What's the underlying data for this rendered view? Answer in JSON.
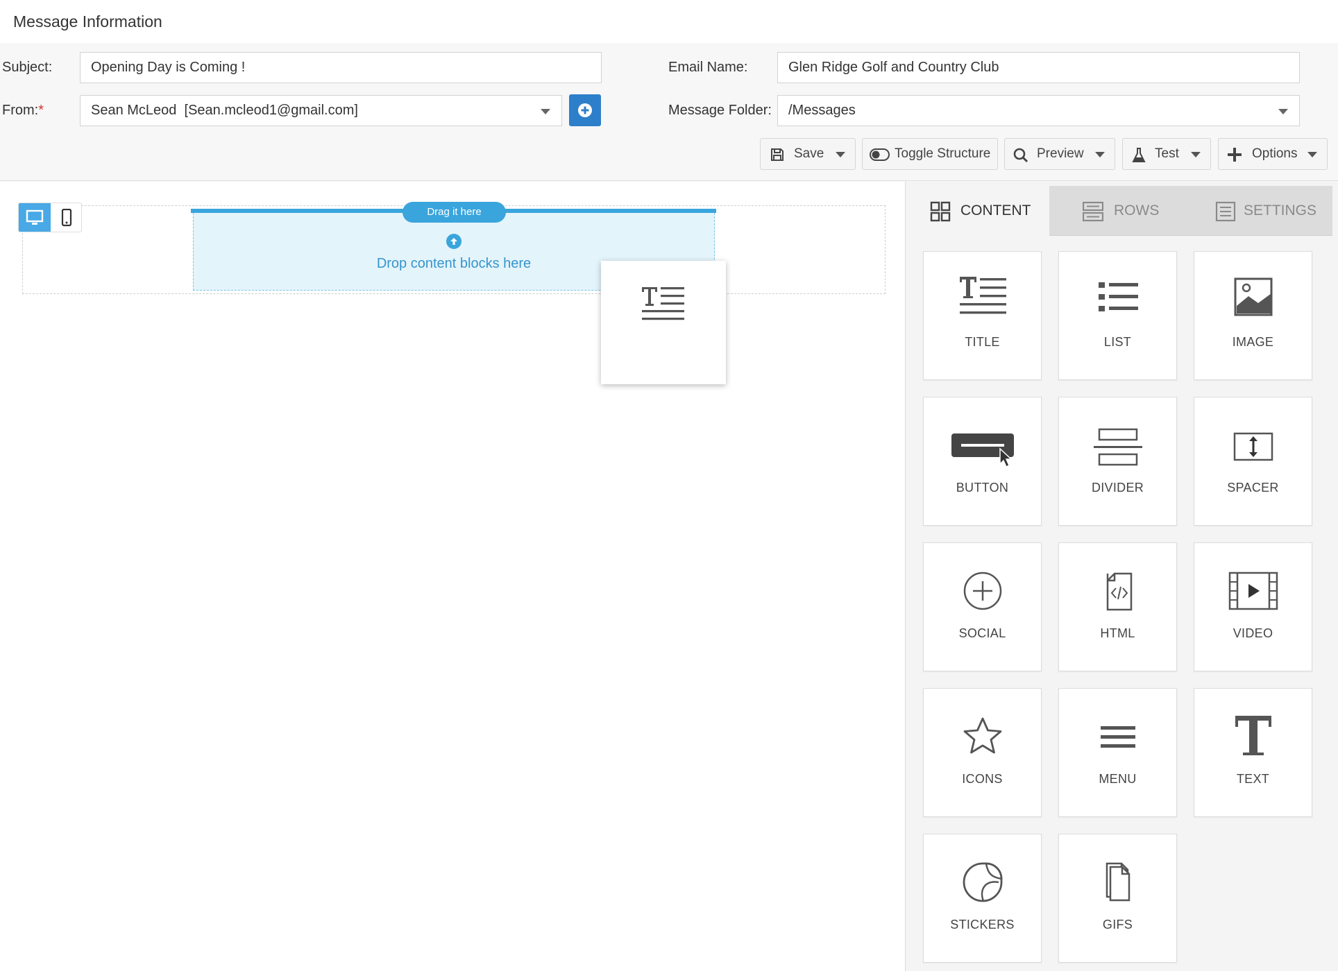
{
  "header": {
    "title": "Message Information"
  },
  "form": {
    "subject_label": "Subject:",
    "subject_value": "Opening Day is Coming !",
    "from_label": "From:",
    "from_required": "*",
    "from_value": "Sean McLeod  [Sean.mcleod1@gmail.com]",
    "email_name_label": "Email Name:",
    "email_name_value": "Glen Ridge Golf and Country Club",
    "folder_label": "Message Folder:",
    "folder_value": "/Messages"
  },
  "toolbar": {
    "save": "Save",
    "toggle_structure": "Toggle Structure",
    "preview": "Preview",
    "test": "Test",
    "options": "Options"
  },
  "canvas": {
    "drag_pill": "Drag it here",
    "drop_text": "Drop content blocks here"
  },
  "panel": {
    "tabs": [
      "CONTENT",
      "ROWS",
      "SETTINGS"
    ],
    "active_tab": "CONTENT",
    "blocks": [
      "TITLE",
      "LIST",
      "IMAGE",
      "BUTTON",
      "DIVIDER",
      "SPACER",
      "SOCIAL",
      "HTML",
      "VIDEO",
      "ICONS",
      "MENU",
      "TEXT",
      "STICKERS",
      "GIFS"
    ]
  },
  "colors": {
    "accent": "#3aa5dc",
    "primary_button": "#2d7fc9",
    "required": "#d9302c"
  }
}
